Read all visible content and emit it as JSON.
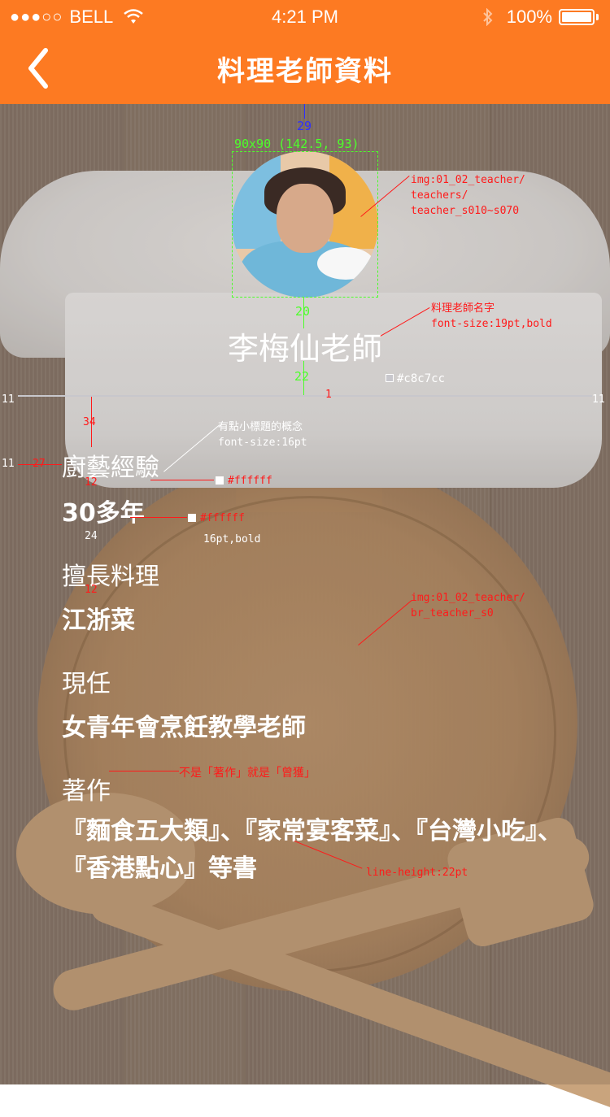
{
  "status_bar": {
    "signal_dots": "●●●○○",
    "carrier": "BELL",
    "time": "4:21 PM",
    "battery_percent": "100%"
  },
  "nav": {
    "title": "料理老師資料"
  },
  "teacher": {
    "name": "李梅仙老師"
  },
  "sections": [
    {
      "label": "廚藝經驗",
      "value": "30多年"
    },
    {
      "label": "擅長料理",
      "value": "江浙菜"
    },
    {
      "label": "現任",
      "value": "女青年會烹飪教學老師"
    },
    {
      "label": "著作",
      "value": "『麵食五大類』、『家常宴客菜』、『台灣小吃』、『香港點心』等書"
    }
  ],
  "annotations": {
    "spacing_top": "29",
    "avatar_size": "90x90 (142.5, 93)",
    "avatar_img": "img:01_02_teacher/\nteachers/\nteacher_s010~s070",
    "gap_name": "20",
    "name_note": "料理老師名字\nfont-size:19pt,bold",
    "gap_divider": "22",
    "divider_color": "#c8c7cc",
    "divider_one": "1",
    "left_inset": "11",
    "right_inset": "11",
    "gap_34": "34",
    "subtitle_note": "有點小標題的概念\nfont-size:16pt",
    "left_27": "27",
    "left_11": "11",
    "label_color": "#ffffff",
    "gap_12a": "12",
    "value_color": "#ffffff",
    "value_note": "16pt,bold",
    "gap_24": "24",
    "gap_12b": "12",
    "bg_img": "img:01_02_teacher/\nbr_teacher_s0",
    "works_note": "不是「著作」就是「曾獲」",
    "line_height_note": "line-height:22pt"
  },
  "colors": {
    "accent": "#fd7a22",
    "divider": "#c8c7cc",
    "text": "#ffffff",
    "annotation_red": "#ff1a1a",
    "annotation_green": "#4cff2a"
  }
}
